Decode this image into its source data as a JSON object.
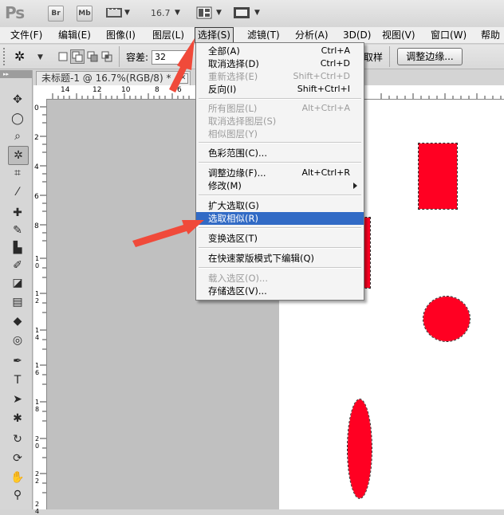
{
  "app": {
    "logo": "Ps",
    "bridge": "Br",
    "minibridge": "Mb",
    "zoom": "16.7"
  },
  "menubar": [
    {
      "label": "文件(F)"
    },
    {
      "label": "编辑(E)"
    },
    {
      "label": "图像(I)"
    },
    {
      "label": "图层(L)"
    },
    {
      "label": "选择(S)"
    },
    {
      "label": "滤镜(T)"
    },
    {
      "label": "分析(A)"
    },
    {
      "label": "3D(D)"
    },
    {
      "label": "视图(V)"
    },
    {
      "label": "窗口(W)"
    },
    {
      "label": "帮助"
    }
  ],
  "options": {
    "tolerance_label": "容差:",
    "tolerance_value": "32",
    "sample_label": "取样",
    "refine_button": "调整边缘..."
  },
  "document": {
    "tab_title": "未标题-1 @ 16.7%(RGB/8) *",
    "ruler_top": [
      "14",
      "12",
      "10",
      "8",
      "6"
    ],
    "ruler_left": [
      "0",
      "2",
      "4",
      "6",
      "8",
      "1 0",
      "1 2",
      "1 4",
      "1 6",
      "1 8",
      "2 0",
      "2 2",
      "2 4"
    ]
  },
  "select_menu": {
    "items": [
      {
        "label": "全部(A)",
        "shortcut": "Ctrl+A",
        "disabled": false
      },
      {
        "label": "取消选择(D)",
        "shortcut": "Ctrl+D",
        "disabled": false
      },
      {
        "label": "重新选择(E)",
        "shortcut": "Shift+Ctrl+D",
        "disabled": true
      },
      {
        "label": "反向(I)",
        "shortcut": "Shift+Ctrl+I",
        "disabled": false
      },
      {
        "label": "所有图层(L)",
        "shortcut": "Alt+Ctrl+A",
        "disabled": true
      },
      {
        "label": "取消选择图层(S)",
        "shortcut": "",
        "disabled": true
      },
      {
        "label": "相似图层(Y)",
        "shortcut": "",
        "disabled": true
      },
      {
        "label": "色彩范围(C)...",
        "shortcut": "",
        "disabled": false
      },
      {
        "label": "调整边缘(F)...",
        "shortcut": "Alt+Ctrl+R",
        "disabled": false
      },
      {
        "label": "修改(M)",
        "shortcut": "",
        "disabled": false
      },
      {
        "label": "扩大选取(G)",
        "shortcut": "",
        "disabled": false
      },
      {
        "label": "选取相似(R)",
        "shortcut": "",
        "disabled": false,
        "highlighted": true
      },
      {
        "label": "变换选区(T)",
        "shortcut": "",
        "disabled": false
      },
      {
        "label": "在快速蒙版模式下编辑(Q)",
        "shortcut": "",
        "disabled": false
      },
      {
        "label": "载入选区(O)...",
        "shortcut": "",
        "disabled": true
      },
      {
        "label": "存储选区(V)...",
        "shortcut": "",
        "disabled": false
      }
    ]
  },
  "colors": {
    "shape_fill": "#ff0022",
    "arrow": "#f05040",
    "highlight": "#316ac5"
  }
}
